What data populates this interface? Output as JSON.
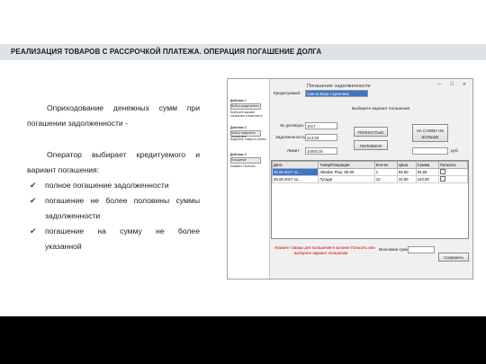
{
  "slide": {
    "title": "РЕАЛИЗАЦИЯ ТОВАРОВ С РАССРОЧКОЙ ПЛАТЕЖА. ОПЕРАЦИЯ ПОГАШЕНИЕ ДОЛГА",
    "para1_line1": "Оприходование денежных сумм при",
    "para1_line2": "погашении задолженности -",
    "para2_line1": "Оператор выбирает кредитуемого и",
    "para2_line2": "вариант погашения:",
    "bullets": [
      {
        "line1": "полное погашение задолженности",
        "line2": ""
      },
      {
        "line1": "погашение не более половины суммы",
        "line2": "задолженности"
      },
      {
        "line1": "погашение на сумму не более",
        "line2": "указанной"
      }
    ]
  },
  "screenshot": {
    "window_title": "Погашение задолженности",
    "controls": "— ☐ ✕",
    "sidebar": [
      {
        "title": "Действие 1",
        "text": "Выбор кредитуемого",
        "note": "Выберите вариант погашения и выполните"
      },
      {
        "title": "Действие 2",
        "text": "Выбор товаров по погашению",
        "note": "Выделите товары в списке"
      },
      {
        "title": "Действие 3",
        "text": "Погашение",
        "note": "Нажмите Погасить"
      }
    ],
    "labels": {
      "creditee": "Кредитуемый:",
      "contract": "№ договора:",
      "debt": "Задолженность:",
      "limit": "Лимит:",
      "choose_variant": "Выберите вариант погашения",
      "currency": "руб.",
      "input_sum": "Вносимая сумма:"
    },
    "values": {
      "creditee": "Смела Вера Сергеевна",
      "contract": "1517",
      "debt": "213,50",
      "limit": "10000,00"
    },
    "buttons": {
      "full": "ПОЛНОСТЬЮ",
      "half": "ПОЛОВИНУ",
      "sum_line1": "НА СУММУ НЕ",
      "sum_line2": "БОЛЬШЕ",
      "save": "Сохранить"
    },
    "table": {
      "headers": [
        "Дата",
        "Товар/Операция",
        "Кол-во",
        "Цена",
        "Сумма",
        "Погасить"
      ],
      "rows": [
        [
          "25.06.2017 11...",
          "Alkaline Plus, 85-00",
          "1",
          "93,50",
          "93,50"
        ],
        [
          "25.06.2017 11...",
          "Гусади",
          "12",
          "10,00",
          "120,00"
        ]
      ]
    },
    "hint_line1": "Укажите товары для погашения в колонке Погасить или",
    "hint_line2": "выберите вариант погашения"
  }
}
